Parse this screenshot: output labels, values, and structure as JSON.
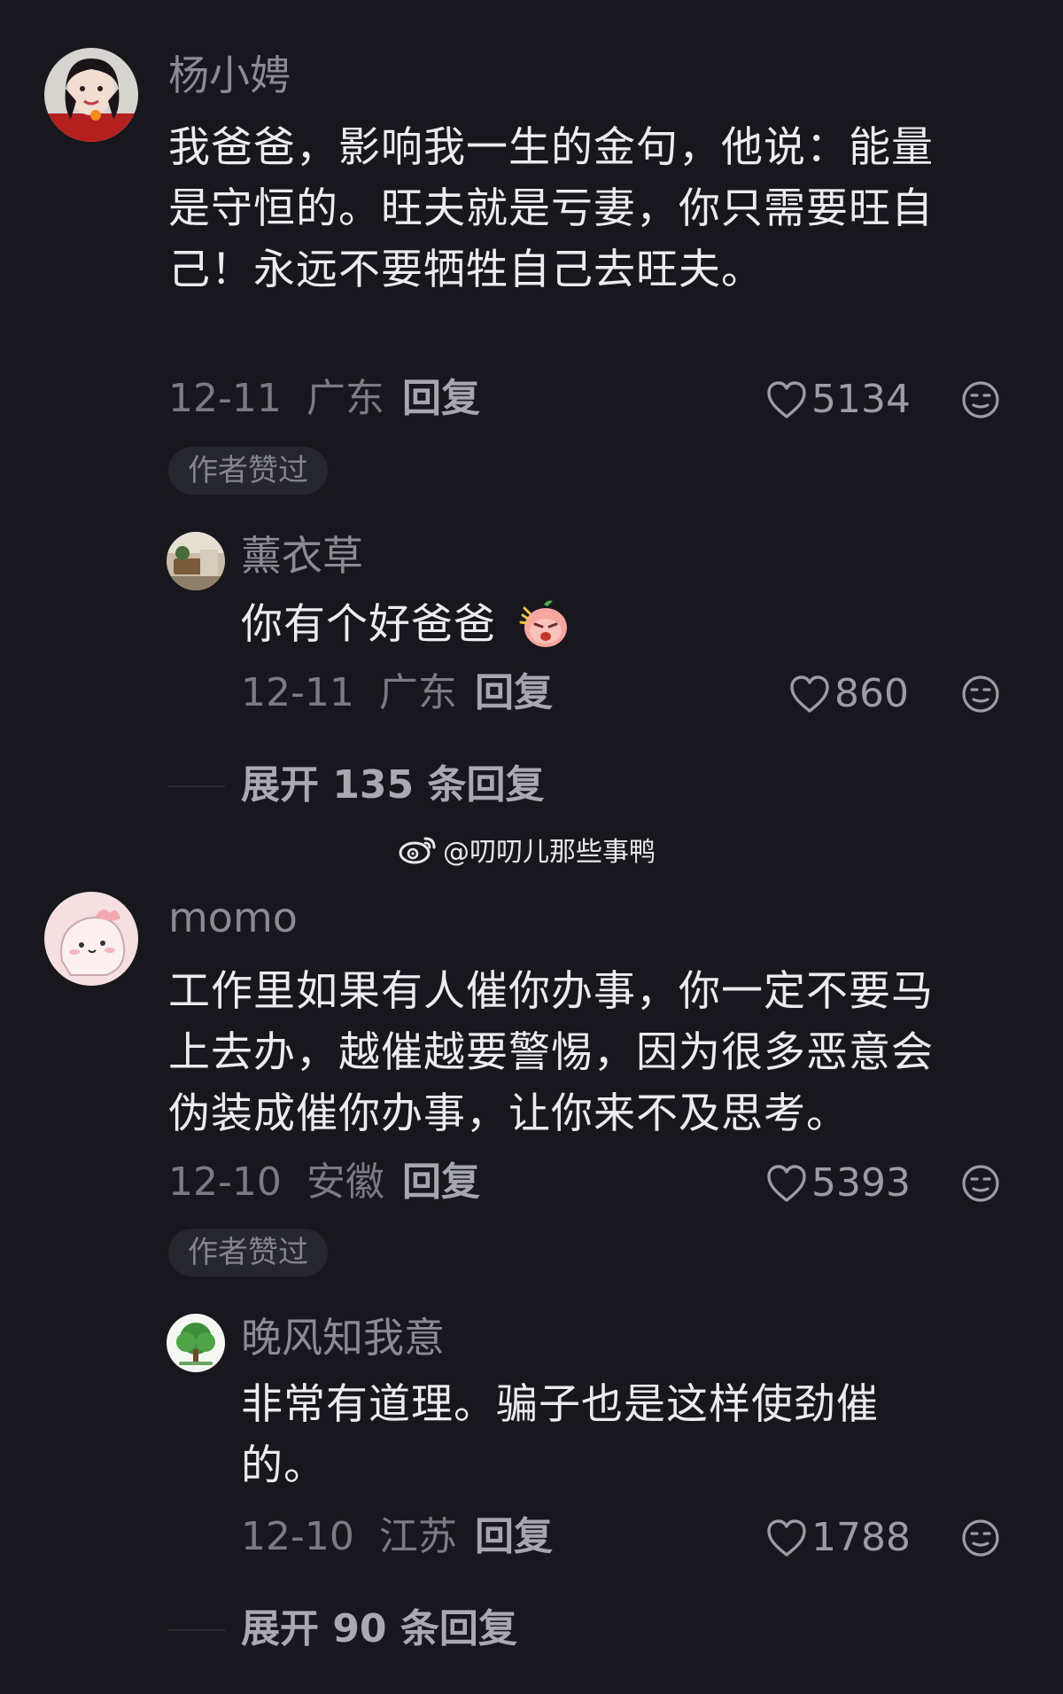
{
  "comments": [
    {
      "username": "杨小娉",
      "text_lines": [
        "我爸爸，影响我一生的金句，他说：能量",
        "是守恒的。旺夫就是亏妻，你只需要旺自",
        "己！永远不要牺牲自己去旺夫。"
      ],
      "date": "12-11",
      "location": "广东",
      "reply_label": "回复",
      "likes": "5134",
      "badge": "作者赞过",
      "reply": {
        "username": "薰衣草",
        "text_lines": [
          "你有个好爸爸"
        ],
        "date": "12-11",
        "location": "广东",
        "reply_label": "回复",
        "likes": "860"
      },
      "expand_label": "展开 135 条回复"
    },
    {
      "username": "momo",
      "text_lines": [
        "工作里如果有人催你办事，你一定不要马",
        "上去办，越催越要警惕，因为很多恶意会",
        "伪装成催你办事，让你来不及思考。"
      ],
      "date": "12-10",
      "location": "安徽",
      "reply_label": "回复",
      "likes": "5393",
      "badge": "作者赞过",
      "reply": {
        "username": "晚风知我意",
        "text_lines": [
          "非常有道理。骗子也是这样使劲催",
          "的。"
        ],
        "date": "12-10",
        "location": "江苏",
        "reply_label": "回复",
        "likes": "1788"
      },
      "expand_label": "展开 90 条回复"
    }
  ],
  "watermark": "@叨叨儿那些事鸭",
  "icons": {
    "like": "heart-outline-icon",
    "dislike": "dislike-face-icon",
    "watermark": "weibo-logo-icon",
    "sticker": "angry-peach-sticker"
  },
  "colors": {
    "background": "#17171d",
    "text_primary": "#ececf0",
    "text_secondary": "#8b8b94",
    "badge_bg": "#26262d"
  }
}
